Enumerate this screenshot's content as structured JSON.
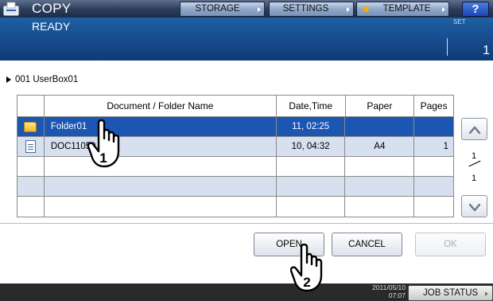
{
  "header": {
    "app_title": "COPY",
    "app_icon": "copy-icon",
    "buttons": {
      "storage": "STORAGE",
      "settings": "SETTINGS",
      "template": "TEMPLATE",
      "help": "?"
    }
  },
  "status": {
    "message": "READY",
    "set_label": "SET",
    "set_value": "1"
  },
  "breadcrumb": {
    "text": "001 UserBox01"
  },
  "table": {
    "headers": {
      "name": "Document / Folder Name",
      "date": "Date,Time",
      "paper": "Paper",
      "pages": "Pages"
    },
    "rows": [
      {
        "icon": "folder-icon",
        "name": "Folder01",
        "date": "11, 02:25",
        "paper": "",
        "pages": "",
        "selected": true
      },
      {
        "icon": "document-icon",
        "name": "DOC11050",
        "date": "10, 04:32",
        "paper": "A4",
        "pages": "1",
        "selected": false
      },
      {
        "icon": "",
        "name": "",
        "date": "",
        "paper": "",
        "pages": "",
        "selected": false
      },
      {
        "icon": "",
        "name": "",
        "date": "",
        "paper": "",
        "pages": "",
        "selected": false
      },
      {
        "icon": "",
        "name": "",
        "date": "",
        "paper": "",
        "pages": "",
        "selected": false
      }
    ]
  },
  "pagination": {
    "current": "1",
    "total": "1"
  },
  "actions": {
    "open": "OPEN",
    "cancel": "CANCEL",
    "ok": "OK"
  },
  "footer": {
    "date": "2011/05/10",
    "time": "07:07",
    "job_status": "JOB STATUS"
  },
  "annotations": {
    "step1": "1",
    "step2": "2"
  }
}
